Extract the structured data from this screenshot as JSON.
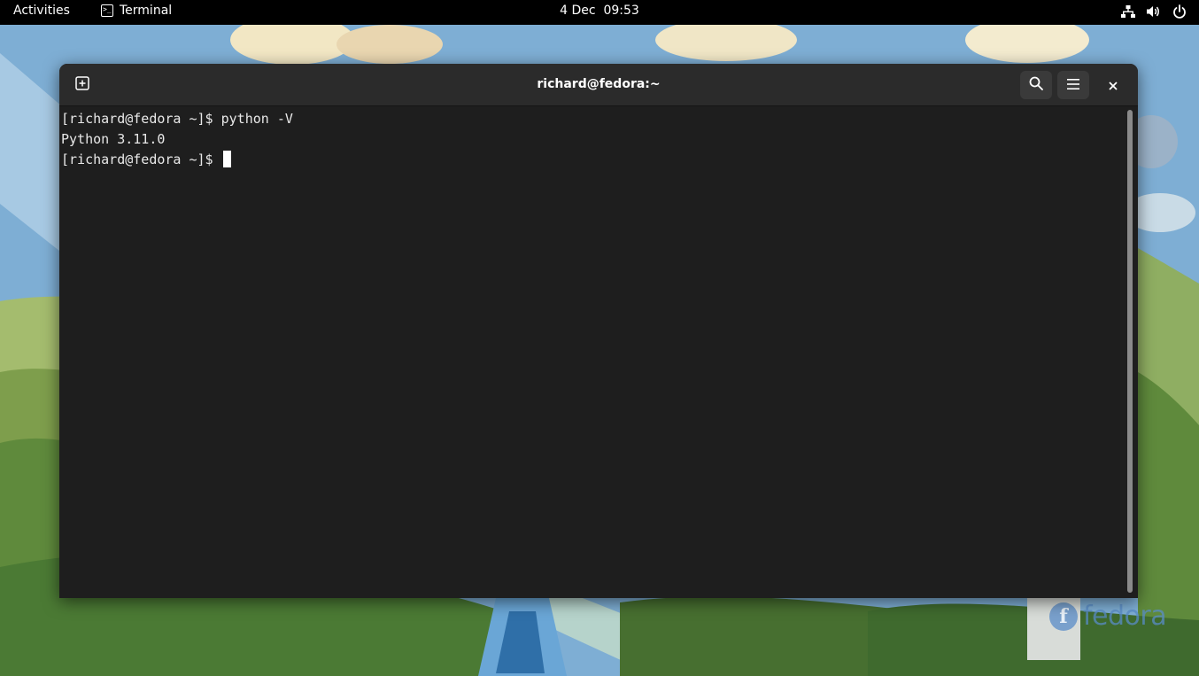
{
  "topbar": {
    "activities_label": "Activities",
    "app_name": "Terminal",
    "clock": "4 Dec  09:53",
    "tray_icons": [
      "network-icon",
      "volume-icon",
      "power-icon"
    ]
  },
  "window": {
    "title": "richard@fedora:~",
    "buttons": [
      "new-tab-icon",
      "search-icon",
      "hamburger-menu-icon",
      "close-icon"
    ]
  },
  "terminal": {
    "lines": [
      "[richard@fedora ~]$ python -V",
      "Python 3.11.0",
      "[richard@fedora ~]$ "
    ]
  },
  "wallpaper": {
    "logo_text": "fedora"
  },
  "colors": {
    "topbar": "#000000",
    "headerbar": "#2b2b2b",
    "terminal_bg": "#1e1e1e",
    "terminal_fg": "#e8e8e8"
  }
}
